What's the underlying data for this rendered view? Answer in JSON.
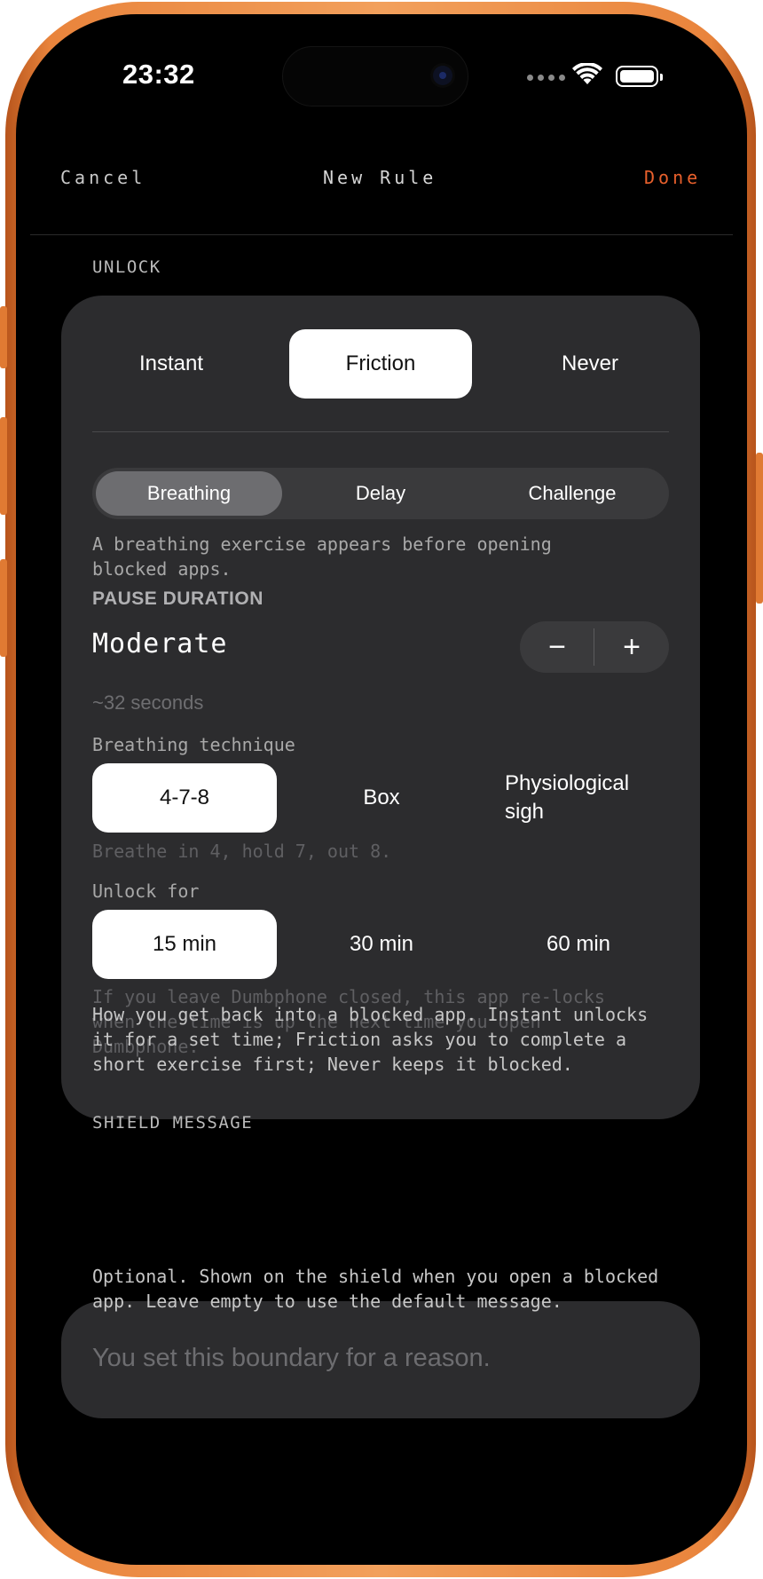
{
  "status_bar": {
    "time": "23:32"
  },
  "nav": {
    "cancel": "Cancel",
    "title": "New Rule",
    "done": "Done"
  },
  "unlock": {
    "section_label": "UNLOCK",
    "modes": [
      {
        "label": "Instant",
        "selected": false
      },
      {
        "label": "Friction",
        "selected": true
      },
      {
        "label": "Never",
        "selected": false
      }
    ],
    "friction_types": [
      {
        "label": "Breathing",
        "selected": true
      },
      {
        "label": "Delay",
        "selected": false
      },
      {
        "label": "Challenge",
        "selected": false
      }
    ],
    "friction_description": "A breathing exercise appears before opening blocked apps.",
    "pause_duration": {
      "label": "PAUSE DURATION",
      "value": "Moderate",
      "decrement": "−",
      "increment": "+",
      "approx": "~32 seconds"
    },
    "technique": {
      "label": "Breathing technique",
      "options": [
        {
          "label": "4-7-8",
          "selected": true
        },
        {
          "label": "Box",
          "selected": false
        },
        {
          "label": "Physiological sigh",
          "selected": false
        }
      ],
      "hint": "Breathe in 4, hold 7, out 8."
    },
    "unlock_for": {
      "label": "Unlock for",
      "options": [
        {
          "label": "15 min",
          "selected": true
        },
        {
          "label": "30 min",
          "selected": false
        },
        {
          "label": "60 min",
          "selected": false
        }
      ],
      "hint": "If you leave Dumbphone closed, this app re-locks when the time is up the next time you open Dumbphone."
    },
    "footer": "How you get back into a blocked app. Instant unlocks it for a set time; Friction asks you to complete a short exercise first; Never keeps it blocked."
  },
  "shield": {
    "section_label": "SHIELD MESSAGE",
    "placeholder": "You set this boundary for a reason.",
    "footer": "Optional. Shown on the shield when you open a blocked app. Leave empty to use the default message."
  },
  "colors": {
    "accent": "#e8602c",
    "frame": "#f2a05c",
    "card": "#2c2c2e",
    "background": "#000000"
  },
  "icons": [
    "wifi-icon",
    "battery-icon",
    "cellular-dots-icon",
    "camera-icon"
  ]
}
